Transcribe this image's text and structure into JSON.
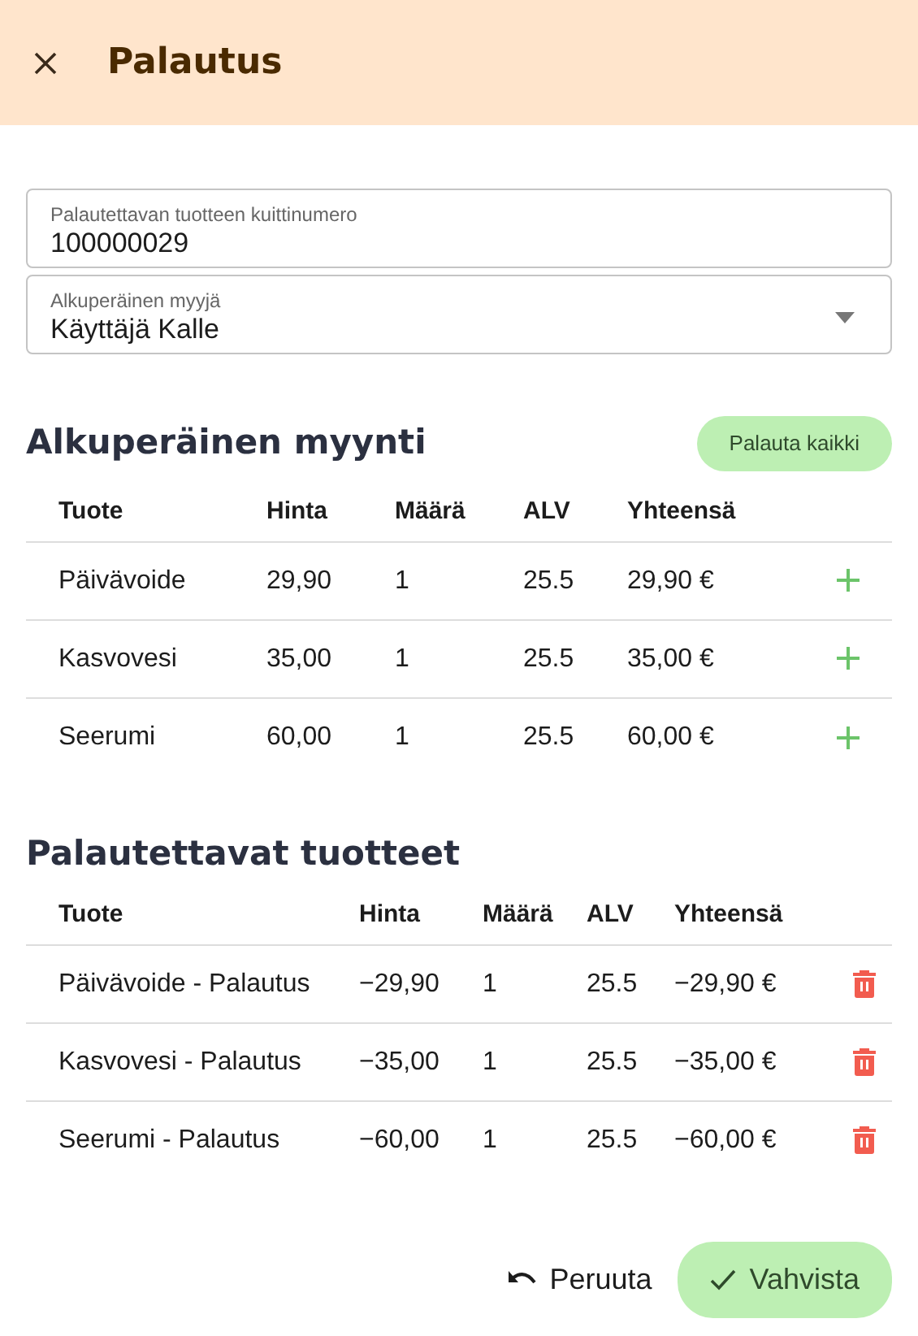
{
  "header": {
    "title": "Palautus"
  },
  "fields": [
    {
      "kind": "text",
      "label": "Palautettavan tuotteen kuittinumero",
      "value": "100000029"
    },
    {
      "kind": "select",
      "label": "Alkuperäinen myyjä",
      "value": "Käyttäjä Kalle"
    }
  ],
  "original_sale": {
    "title": "Alkuperäinen myynti",
    "button": "Palauta kaikki",
    "columns": [
      "Tuote",
      "Hinta",
      "Määrä",
      "ALV",
      "Yhteensä"
    ],
    "rows": [
      {
        "cells": [
          "Päivävoide",
          "29,90",
          "1",
          "25.5",
          "29,90 €"
        ]
      },
      {
        "cells": [
          "Kasvovesi",
          "35,00",
          "1",
          "25.5",
          "35,00 €"
        ]
      },
      {
        "cells": [
          "Seerumi",
          "60,00",
          "1",
          "25.5",
          "60,00 €"
        ]
      }
    ]
  },
  "returned_items": {
    "title": "Palautettavat tuotteet",
    "columns": [
      "Tuote",
      "Hinta",
      "Määrä",
      "ALV",
      "Yhteensä"
    ],
    "rows": [
      {
        "cells": [
          "Päivävoide - Palautus",
          "−29,90",
          "1",
          "25.5",
          "−29,90 €"
        ]
      },
      {
        "cells": [
          "Kasvovesi - Palautus",
          "−35,00",
          "1",
          "25.5",
          "−35,00 €"
        ]
      },
      {
        "cells": [
          "Seerumi - Palautus",
          "−60,00",
          "1",
          "25.5",
          "−60,00 €"
        ]
      }
    ]
  },
  "footer": {
    "cancel": "Peruuta",
    "confirm": "Vahvista"
  }
}
